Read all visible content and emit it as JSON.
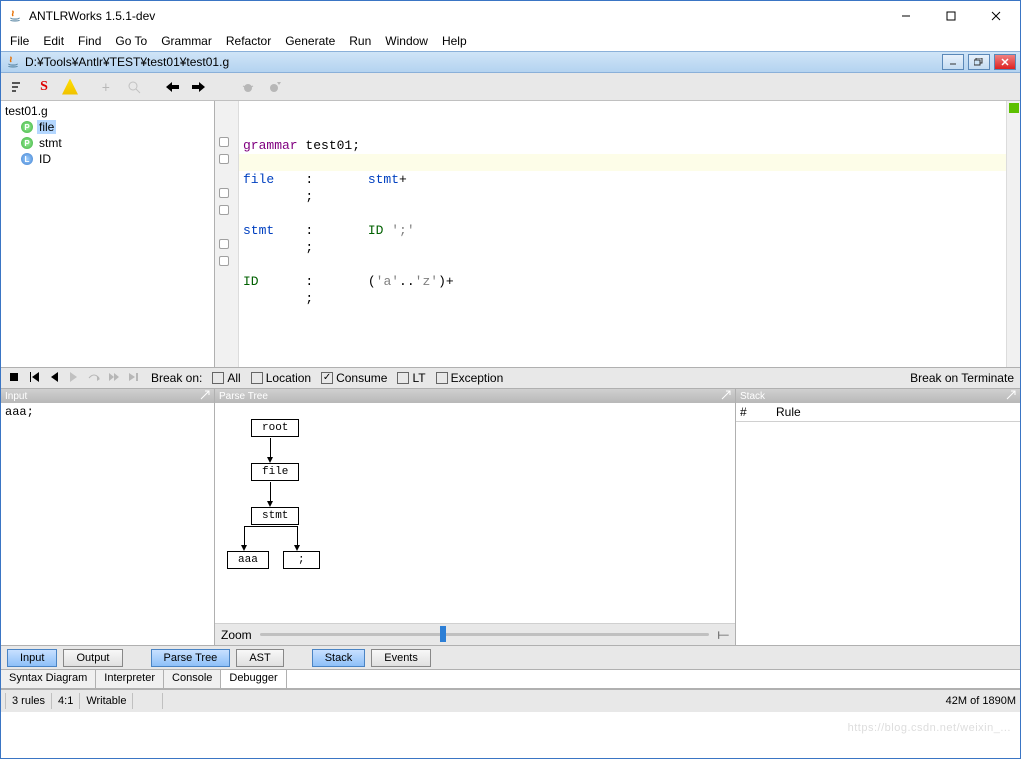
{
  "window": {
    "title": "ANTLRWorks 1.5.1-dev"
  },
  "menu": [
    "File",
    "Edit",
    "Find",
    "Go To",
    "Grammar",
    "Refactor",
    "Generate",
    "Run",
    "Window",
    "Help"
  ],
  "doc_path": "D:¥Tools¥Antlr¥TEST¥test01¥test01.g",
  "tree": {
    "root": "test01.g",
    "items": [
      {
        "label": "file",
        "kind": "P",
        "selected": true
      },
      {
        "label": "stmt",
        "kind": "P",
        "selected": false
      },
      {
        "label": "ID",
        "kind": "L",
        "selected": false
      }
    ]
  },
  "grammar_source": {
    "lines": [
      {
        "t": "grammar test01;",
        "cls": "kw"
      },
      {
        "t": ""
      },
      {
        "rule": "file",
        "op": ":",
        "rhs": "stmt+",
        "rclass": "rule"
      },
      {
        "rule": "",
        "op": ";",
        "rhs": ""
      },
      {
        "t": ""
      },
      {
        "rule": "stmt",
        "op": ":",
        "rhs_tokens": [
          {
            "t": "ID",
            "c": "lexr"
          },
          {
            "t": " "
          },
          {
            "t": "';'",
            "c": "lit"
          }
        ]
      },
      {
        "rule": "",
        "op": ";",
        "rhs": ""
      },
      {
        "t": ""
      },
      {
        "rule": "ID",
        "op": ":",
        "rhs": "('a'..'z')+",
        "rrule": "lexr",
        "rclass": "lit"
      },
      {
        "rule": "",
        "op": ";",
        "rhs": ""
      }
    ]
  },
  "debugger": {
    "break_label": "Break on:",
    "opts": [
      {
        "label": "All",
        "on": false
      },
      {
        "label": "Location",
        "on": false
      },
      {
        "label": "Consume",
        "on": true
      },
      {
        "label": "LT",
        "on": false
      },
      {
        "label": "Exception",
        "on": false
      }
    ],
    "break_terminate": "Break on Terminate"
  },
  "panel_titles": {
    "input": "Input",
    "parse": "Parse Tree",
    "stack": "Stack"
  },
  "input_text": "aaa;",
  "parse_tree": {
    "nodes": [
      "root",
      "file",
      "stmt",
      "aaa",
      ";"
    ]
  },
  "zoom_label": "Zoom",
  "stack_cols": {
    "c1": "#",
    "c2": "Rule"
  },
  "buttons": {
    "row1": [
      {
        "label": "Input",
        "on": true
      },
      {
        "label": "Output",
        "on": false
      }
    ],
    "row2": [
      {
        "label": "Parse Tree",
        "on": true
      },
      {
        "label": "AST",
        "on": false
      }
    ],
    "row3": [
      {
        "label": "Stack",
        "on": true
      },
      {
        "label": "Events",
        "on": false
      }
    ]
  },
  "tabs": [
    "Syntax Diagram",
    "Interpreter",
    "Console",
    "Debugger"
  ],
  "active_tab": "Debugger",
  "status": {
    "rules": "3 rules",
    "pos": "4:1",
    "mode": "Writable",
    "mem": "42M of 1890M"
  },
  "watermark": "https://blog.csdn.net/weixin_..."
}
